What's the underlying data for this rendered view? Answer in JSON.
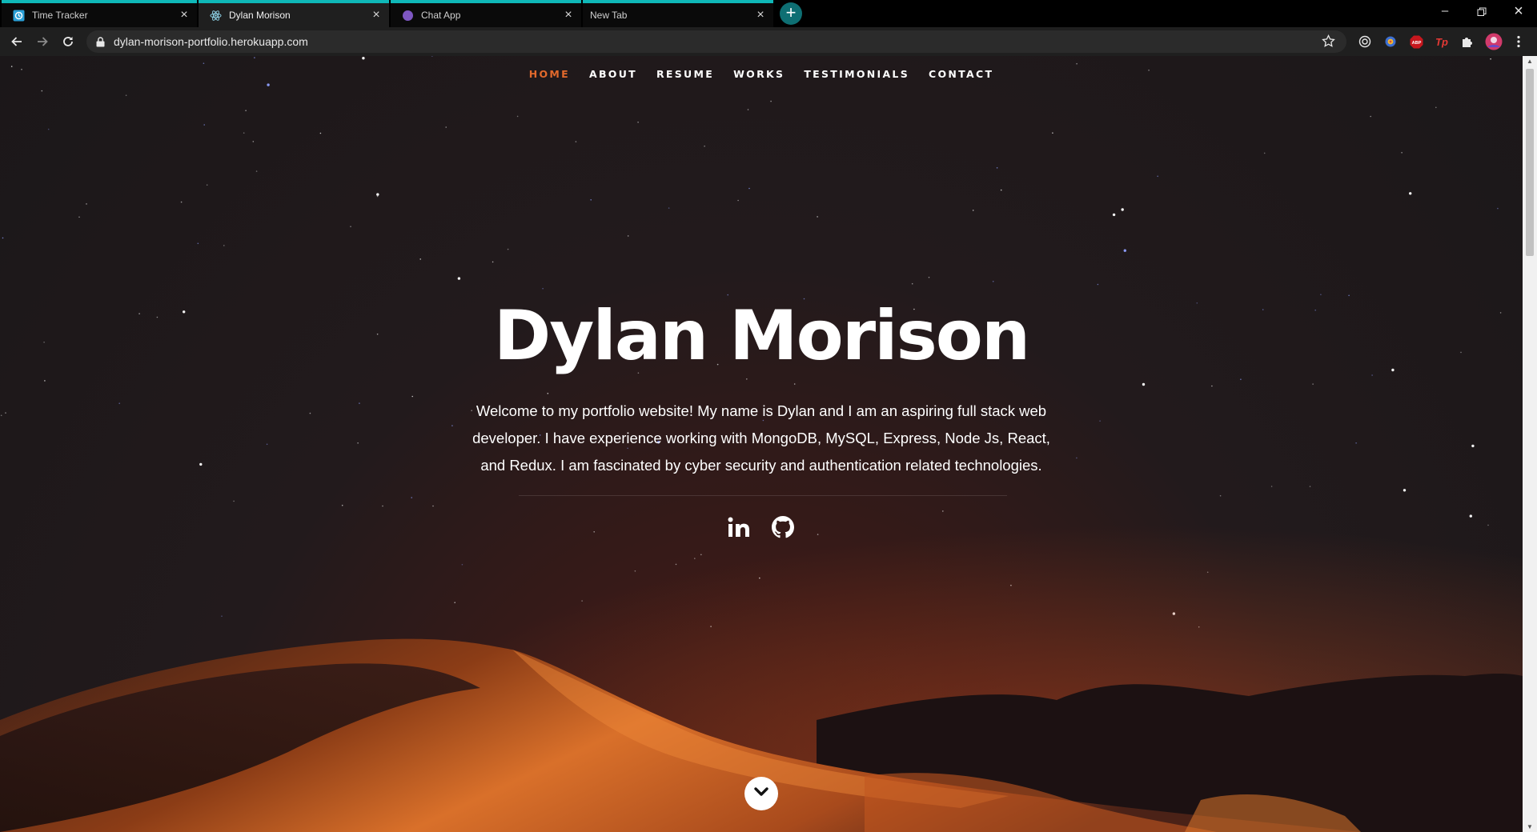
{
  "browser": {
    "tabs": [
      {
        "title": "Time Tracker",
        "favicon": "clock-gear-icon",
        "active": false
      },
      {
        "title": "Dylan Morison",
        "favicon": "react-atom-icon",
        "active": true
      },
      {
        "title": "Chat App",
        "favicon": "purple-dot-icon",
        "active": false
      },
      {
        "title": "New Tab",
        "favicon": "none",
        "active": false
      }
    ],
    "new_tab_label": "+",
    "url": "dylan-morison-portfolio.herokuapp.com",
    "accent_color": "#0fb8b8",
    "extensions": [
      "target-icon",
      "colorful-extension-icon",
      "abp-icon",
      "tp-icon",
      "puzzle-piece-icon",
      "profile-avatar-icon"
    ],
    "abp_label": "ABP",
    "tp_label": "Tp"
  },
  "page": {
    "nav": [
      {
        "label": "HOME",
        "current": true
      },
      {
        "label": "ABOUT",
        "current": false
      },
      {
        "label": "RESUME",
        "current": false
      },
      {
        "label": "WORKS",
        "current": false
      },
      {
        "label": "TESTIMONIALS",
        "current": false
      },
      {
        "label": "CONTACT",
        "current": false
      }
    ],
    "accent_color": "#e2692c",
    "hero": {
      "title": "Dylan Morison",
      "intro": "Welcome to my portfolio website! My name is Dylan and I am an aspiring full stack web developer. I have experience working with MongoDB, MySQL, Express, Node Js, React, and Redux. I am fascinated by cyber security and authentication related technologies."
    },
    "social": [
      "linkedin-icon",
      "github-icon"
    ],
    "scroll_icon": "chevron-down-icon"
  }
}
